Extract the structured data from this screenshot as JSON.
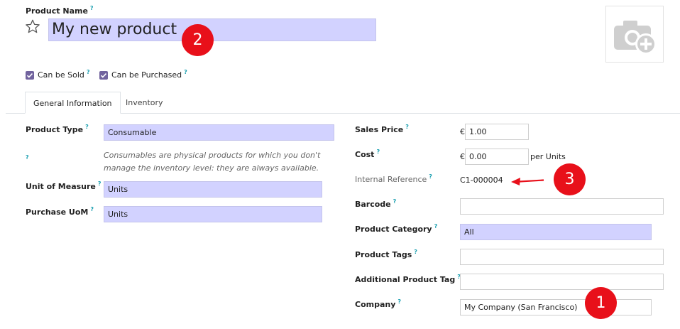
{
  "product": {
    "name_label": "Product Name",
    "name_value": "My new product",
    "can_be_sold_label": "Can be Sold",
    "can_be_purchased_label": "Can be Purchased",
    "help_mark": "?"
  },
  "tabs": [
    {
      "label": "General Information",
      "active": true
    },
    {
      "label": "Inventory",
      "active": false
    }
  ],
  "left": {
    "product_type_label": "Product Type",
    "product_type_value": "Consumable",
    "product_type_note": "Consumables are physical products for which you don't manage the inventory level: they are always available.",
    "uom_label": "Unit of Measure",
    "uom_value": "Units",
    "purchase_uom_label": "Purchase UoM",
    "purchase_uom_value": "Units"
  },
  "right": {
    "sales_price_label": "Sales Price",
    "currency_symbol": "€",
    "sales_price_value": "1.00",
    "cost_label": "Cost",
    "cost_value": "0.00",
    "cost_suffix": "per Units",
    "internal_ref_label": "Internal Reference",
    "internal_ref_value": "C1-000004",
    "barcode_label": "Barcode",
    "barcode_value": "",
    "category_label": "Product Category",
    "category_value": "All",
    "tags_label": "Product Tags",
    "tags_value": "",
    "additional_tag_label": "Additional Product Tag",
    "additional_tag_value": "",
    "company_label": "Company",
    "company_value": "My Company (San Francisco)"
  },
  "annotations": {
    "badge_1": "1",
    "badge_2": "2",
    "badge_3": "3"
  },
  "colors": {
    "required_field": "#d2d2ff",
    "checkbox": "#71639e",
    "help": "#1a9fb0",
    "annotation": "#e8101a"
  },
  "icons": {
    "favorite": "star-outline-icon",
    "image_placeholder": "camera-add-icon",
    "reference_arrow": "arrow-left-icon"
  }
}
